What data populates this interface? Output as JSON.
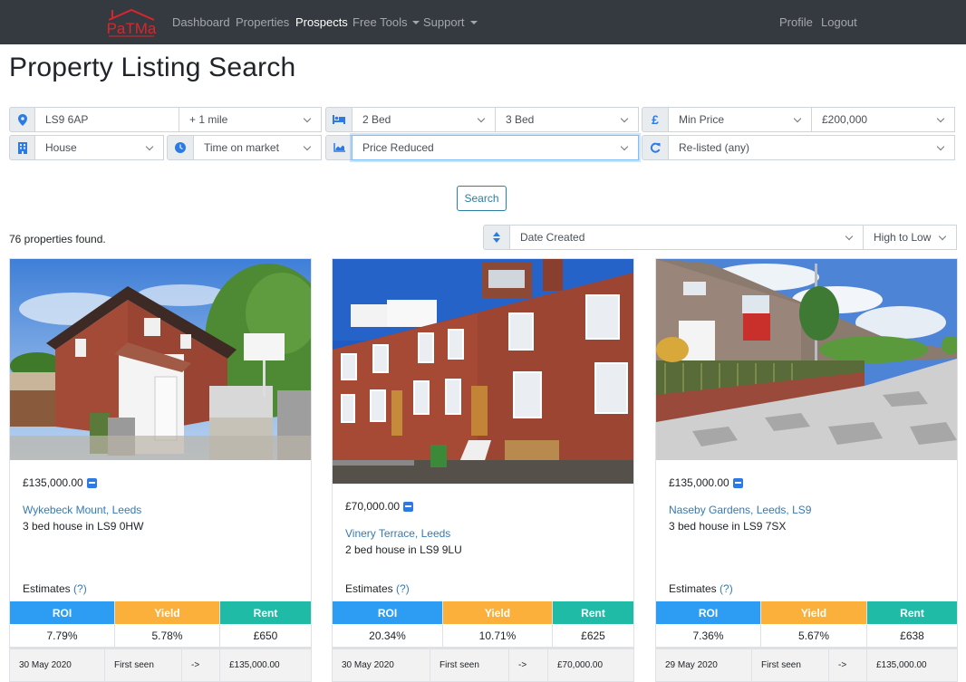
{
  "nav": {
    "brand": "PaTMa",
    "items": [
      {
        "label": "Dashboard",
        "active": false
      },
      {
        "label": "Properties",
        "active": false
      },
      {
        "label": "Prospects",
        "active": true
      },
      {
        "label": "Free Tools",
        "dropdown": true
      },
      {
        "label": "Support",
        "dropdown": true
      }
    ],
    "right": [
      {
        "label": "Profile"
      },
      {
        "label": "Logout"
      }
    ]
  },
  "page": {
    "title": "Property Listing Search"
  },
  "filters": {
    "location": {
      "icon": "map-marker-icon",
      "value": "LS9 6AP"
    },
    "radius": {
      "value": "+ 1 mile"
    },
    "beds_min": {
      "icon": "bed-icon",
      "value": "2 Bed"
    },
    "beds_max": {
      "value": "3 Bed"
    },
    "price_min": {
      "icon": "pound-icon",
      "value": "Min Price"
    },
    "price_max": {
      "value": "£200,000"
    },
    "property_type": {
      "icon": "building-icon",
      "value": "House"
    },
    "time_on_market": {
      "icon": "clock-icon",
      "value": "Time on market"
    },
    "price_change": {
      "icon": "chart-area-icon",
      "value": "Price Reduced"
    },
    "relisted": {
      "icon": "redo-icon",
      "value": "Re-listed (any)"
    }
  },
  "search_button": "Search",
  "results": {
    "count_text": "76 properties found."
  },
  "sort": {
    "icon": "sort-icon",
    "field": "Date Created",
    "order": "High to Low"
  },
  "colors": {
    "roi": "#2d9cf3",
    "yield": "#fbb03b",
    "rent": "#1fbba6",
    "link": "#337ab7",
    "navbar": "#343a40",
    "accent_icon": "#2c7be5"
  },
  "estimates_label": "Estimates",
  "estimates_help": "(?)",
  "metric_headers": {
    "roi": "ROI",
    "yield": "Yield",
    "rent": "Rent"
  },
  "listings": [
    {
      "price": "£135,000.00",
      "address": "Wykebeck Mount, Leeds",
      "description": "3 bed house in LS9 0HW",
      "roi": "7.79%",
      "yield": "5.78%",
      "rent": "£650",
      "history": {
        "date": "30 May 2020",
        "event": "First seen",
        "arrow": "->",
        "price": "£135,000.00"
      }
    },
    {
      "price": "£70,000.00",
      "address": "Vinery Terrace, Leeds",
      "description": "2 bed house in LS9 9LU",
      "roi": "20.34%",
      "yield": "10.71%",
      "rent": "£625",
      "history": {
        "date": "30 May 2020",
        "event": "First seen",
        "arrow": "->",
        "price": "£70,000.00"
      }
    },
    {
      "price": "£135,000.00",
      "address": "Naseby Gardens, Leeds, LS9",
      "description": "3 bed house in LS9 7SX",
      "roi": "7.36%",
      "yield": "5.67%",
      "rent": "£638",
      "history": {
        "date": "29 May 2020",
        "event": "First seen",
        "arrow": "->",
        "price": "£135,000.00"
      }
    }
  ]
}
